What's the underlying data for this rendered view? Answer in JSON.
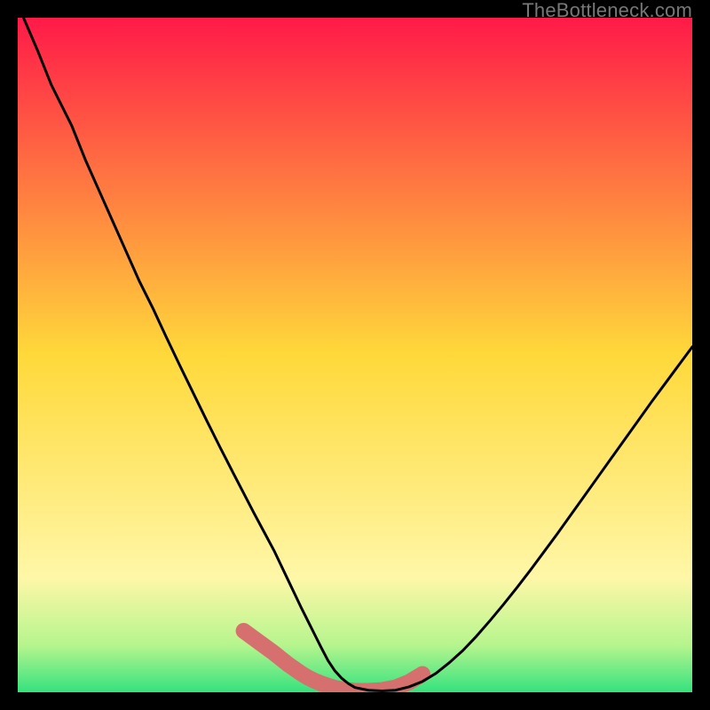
{
  "watermark": "TheBottleneck.com",
  "colors": {
    "bg": "#000000",
    "curve": "#000000",
    "accent": "#d6706f",
    "grad_top": "#ff1a48",
    "grad_mid": "#ffd93a",
    "grad_low1": "#fff7a8",
    "grad_low2": "#b6f58e",
    "grad_bot": "#35e27e"
  },
  "chart_data": {
    "type": "line",
    "title": "",
    "xlabel": "",
    "ylabel": "",
    "xlim": [
      0,
      100
    ],
    "ylim": [
      0,
      100
    ],
    "x": [
      0,
      3,
      5,
      8,
      10,
      12,
      14,
      16,
      18,
      20,
      22,
      24,
      26,
      28,
      30,
      32,
      33.5,
      35,
      36.5,
      38,
      39,
      40,
      41,
      42,
      43,
      44,
      45,
      46,
      47,
      48,
      49,
      50,
      52,
      54,
      56,
      58,
      60,
      62,
      64,
      66,
      68,
      70,
      72,
      74,
      76,
      78,
      80,
      82,
      84,
      86,
      88,
      90,
      92,
      94,
      96,
      98,
      100
    ],
    "values": [
      102,
      95,
      90,
      84,
      79,
      74.5,
      70,
      65.5,
      61,
      57,
      52.7,
      48.5,
      44.4,
      40.3,
      36.3,
      32.4,
      29.5,
      26.6,
      23.8,
      21,
      18.9,
      16.8,
      14.7,
      12.6,
      10.6,
      8.6,
      6.6,
      4.7,
      3.2,
      2.1,
      1.3,
      0.7,
      0.3,
      0.2,
      0.3,
      0.8,
      1.6,
      2.8,
      4.4,
      6.2,
      8.3,
      10.6,
      13,
      15.5,
      18.1,
      20.8,
      23.5,
      26.3,
      29.1,
      31.9,
      34.7,
      37.5,
      40.3,
      43.1,
      45.8,
      48.5,
      51.2
    ],
    "accent_segment": {
      "x": [
        33.5,
        35,
        36.5,
        38,
        39,
        40,
        41,
        42,
        43,
        44,
        45,
        46,
        47,
        48,
        49,
        50,
        52,
        54,
        56,
        58,
        60
      ],
      "values": [
        9.1,
        8.0,
        6.9,
        5.8,
        5.0,
        4.2,
        3.5,
        2.8,
        2.2,
        1.7,
        1.3,
        0.95,
        0.65,
        0.45,
        0.3,
        0.22,
        0.2,
        0.32,
        0.7,
        1.5,
        2.7
      ]
    }
  }
}
